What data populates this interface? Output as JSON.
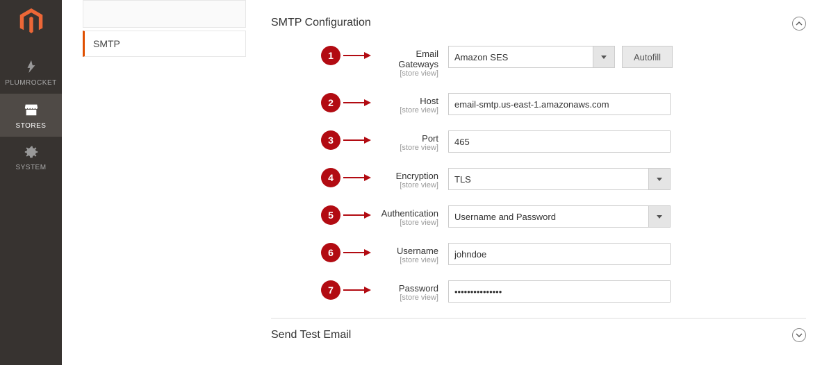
{
  "nav": {
    "items": [
      {
        "label": "PLUMROCKET"
      },
      {
        "label": "STORES"
      },
      {
        "label": "SYSTEM"
      }
    ]
  },
  "subnav": {
    "item": "SMTP"
  },
  "section": {
    "title": "SMTP Configuration",
    "scope_text": "[store view]",
    "rows": [
      {
        "num": "1",
        "label": "Email Gateways",
        "value": "Amazon SES",
        "autofill": "Autofill"
      },
      {
        "num": "2",
        "label": "Host",
        "value": "email-smtp.us-east-1.amazonaws.com"
      },
      {
        "num": "3",
        "label": "Port",
        "value": "465"
      },
      {
        "num": "4",
        "label": "Encryption",
        "value": "TLS"
      },
      {
        "num": "5",
        "label": "Authentication",
        "value": "Username and Password"
      },
      {
        "num": "6",
        "label": "Username",
        "value": "johndoe"
      },
      {
        "num": "7",
        "label": "Password",
        "value": "•••••••••••••••"
      }
    ]
  },
  "section2": {
    "title": "Send Test Email"
  }
}
